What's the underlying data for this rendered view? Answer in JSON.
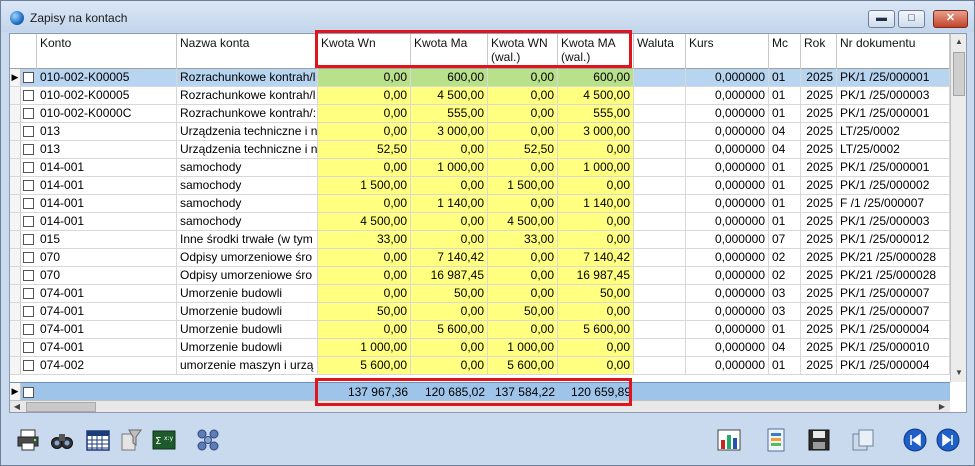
{
  "window": {
    "title": "Zapisy na kontach"
  },
  "columns": {
    "konto": "Konto",
    "nazwa": "Nazwa konta",
    "kwota_wn": "Kwota Wn",
    "kwota_ma": "Kwota Ma",
    "kwota_wn_wal": "Kwota WN",
    "kwota_wn_wal_sub": "(wal.)",
    "kwota_ma_wal": "Kwota MA",
    "kwota_ma_wal_sub": "(wal.)",
    "waluta": "Waluta",
    "kurs": "Kurs",
    "mc": "Mc",
    "rok": "Rok",
    "nr": "Nr dokumentu"
  },
  "rows": [
    {
      "konto": "010-002-K00005",
      "nazwa": "Rozrachunkowe kontrah/l",
      "wn": "0,00",
      "ma": "600,00",
      "wnw": "0,00",
      "maw": "600,00",
      "waluta": "",
      "kurs": "0,000000",
      "mc": "01",
      "rok": "2025",
      "nr": "PK/1  /25/000001"
    },
    {
      "konto": "010-002-K00005",
      "nazwa": "Rozrachunkowe kontrah/l",
      "wn": "0,00",
      "ma": "4 500,00",
      "wnw": "0,00",
      "maw": "4 500,00",
      "waluta": "",
      "kurs": "0,000000",
      "mc": "01",
      "rok": "2025",
      "nr": "PK/1  /25/000003"
    },
    {
      "konto": "010-002-K0000C",
      "nazwa": "Rozrachunkowe kontrah/:",
      "wn": "0,00",
      "ma": "555,00",
      "wnw": "0,00",
      "maw": "555,00",
      "waluta": "",
      "kurs": "0,000000",
      "mc": "01",
      "rok": "2025",
      "nr": "PK/1  /25/000001"
    },
    {
      "konto": "013",
      "nazwa": "Urządzenia techniczne i n",
      "wn": "0,00",
      "ma": "3 000,00",
      "wnw": "0,00",
      "maw": "3 000,00",
      "waluta": "",
      "kurs": "0,000000",
      "mc": "04",
      "rok": "2025",
      "nr": "LT/25/0002"
    },
    {
      "konto": "013",
      "nazwa": "Urządzenia techniczne i n",
      "wn": "52,50",
      "ma": "0,00",
      "wnw": "52,50",
      "maw": "0,00",
      "waluta": "",
      "kurs": "0,000000",
      "mc": "04",
      "rok": "2025",
      "nr": "LT/25/0002"
    },
    {
      "konto": "014-001",
      "nazwa": "samochody",
      "wn": "0,00",
      "ma": "1 000,00",
      "wnw": "0,00",
      "maw": "1 000,00",
      "waluta": "",
      "kurs": "0,000000",
      "mc": "01",
      "rok": "2025",
      "nr": "PK/1  /25/000001"
    },
    {
      "konto": "014-001",
      "nazwa": "samochody",
      "wn": "1 500,00",
      "ma": "0,00",
      "wnw": "1 500,00",
      "maw": "0,00",
      "waluta": "",
      "kurs": "0,000000",
      "mc": "01",
      "rok": "2025",
      "nr": "PK/1  /25/000002"
    },
    {
      "konto": "014-001",
      "nazwa": "samochody",
      "wn": "0,00",
      "ma": "1 140,00",
      "wnw": "0,00",
      "maw": "1 140,00",
      "waluta": "",
      "kurs": "0,000000",
      "mc": "01",
      "rok": "2025",
      "nr": "F /1  /25/000007"
    },
    {
      "konto": "014-001",
      "nazwa": "samochody",
      "wn": "4 500,00",
      "ma": "0,00",
      "wnw": "4 500,00",
      "maw": "0,00",
      "waluta": "",
      "kurs": "0,000000",
      "mc": "01",
      "rok": "2025",
      "nr": "PK/1  /25/000003"
    },
    {
      "konto": "015",
      "nazwa": "Inne środki trwałe (w tym",
      "wn": "33,00",
      "ma": "0,00",
      "wnw": "33,00",
      "maw": "0,00",
      "waluta": "",
      "kurs": "0,000000",
      "mc": "07",
      "rok": "2025",
      "nr": "PK/1  /25/000012"
    },
    {
      "konto": "070",
      "nazwa": "Odpisy umorzeniowe śro",
      "wn": "0,00",
      "ma": "7 140,42",
      "wnw": "0,00",
      "maw": "7 140,42",
      "waluta": "",
      "kurs": "0,000000",
      "mc": "02",
      "rok": "2025",
      "nr": "PK/21 /25/000028"
    },
    {
      "konto": "070",
      "nazwa": "Odpisy umorzeniowe śro",
      "wn": "0,00",
      "ma": "16 987,45",
      "wnw": "0,00",
      "maw": "16 987,45",
      "waluta": "",
      "kurs": "0,000000",
      "mc": "02",
      "rok": "2025",
      "nr": "PK/21 /25/000028"
    },
    {
      "konto": "074-001",
      "nazwa": "Umorzenie budowli",
      "wn": "0,00",
      "ma": "50,00",
      "wnw": "0,00",
      "maw": "50,00",
      "waluta": "",
      "kurs": "0,000000",
      "mc": "03",
      "rok": "2025",
      "nr": "PK/1  /25/000007"
    },
    {
      "konto": "074-001",
      "nazwa": "Umorzenie budowli",
      "wn": "50,00",
      "ma": "0,00",
      "wnw": "50,00",
      "maw": "0,00",
      "waluta": "",
      "kurs": "0,000000",
      "mc": "03",
      "rok": "2025",
      "nr": "PK/1  /25/000007"
    },
    {
      "konto": "074-001",
      "nazwa": "Umorzenie budowli",
      "wn": "0,00",
      "ma": "5 600,00",
      "wnw": "0,00",
      "maw": "5 600,00",
      "waluta": "",
      "kurs": "0,000000",
      "mc": "01",
      "rok": "2025",
      "nr": "PK/1  /25/000004"
    },
    {
      "konto": "074-001",
      "nazwa": "Umorzenie budowli",
      "wn": "1 000,00",
      "ma": "0,00",
      "wnw": "1 000,00",
      "maw": "0,00",
      "waluta": "",
      "kurs": "0,000000",
      "mc": "04",
      "rok": "2025",
      "nr": "PK/1  /25/000010"
    },
    {
      "konto": "074-002",
      "nazwa": "umorzenie maszyn i urzą",
      "wn": "5 600,00",
      "ma": "0,00",
      "wnw": "5 600,00",
      "maw": "0,00",
      "waluta": "",
      "kurs": "0,000000",
      "mc": "01",
      "rok": "2025",
      "nr": "PK/1  /25/000004"
    }
  ],
  "totals": {
    "wn": "137 967,36",
    "ma": "120 685,02",
    "wnw": "137 584,22",
    "maw": "120 659,89"
  },
  "icons": {
    "toolbar": [
      "printer-icon",
      "binoculars-icon",
      "calendar-grid-icon",
      "filter-icon",
      "formula-icon",
      "network-icon",
      "chart-icon",
      "document-icon",
      "save-icon",
      "copy-icon",
      "previous-icon",
      "next-icon"
    ]
  },
  "colors": {
    "highlight_yellow": "#ffff80",
    "selected_row": "#b7d4f0",
    "totals_bar": "#9ec4ea",
    "annotation_red": "#e0141c"
  }
}
